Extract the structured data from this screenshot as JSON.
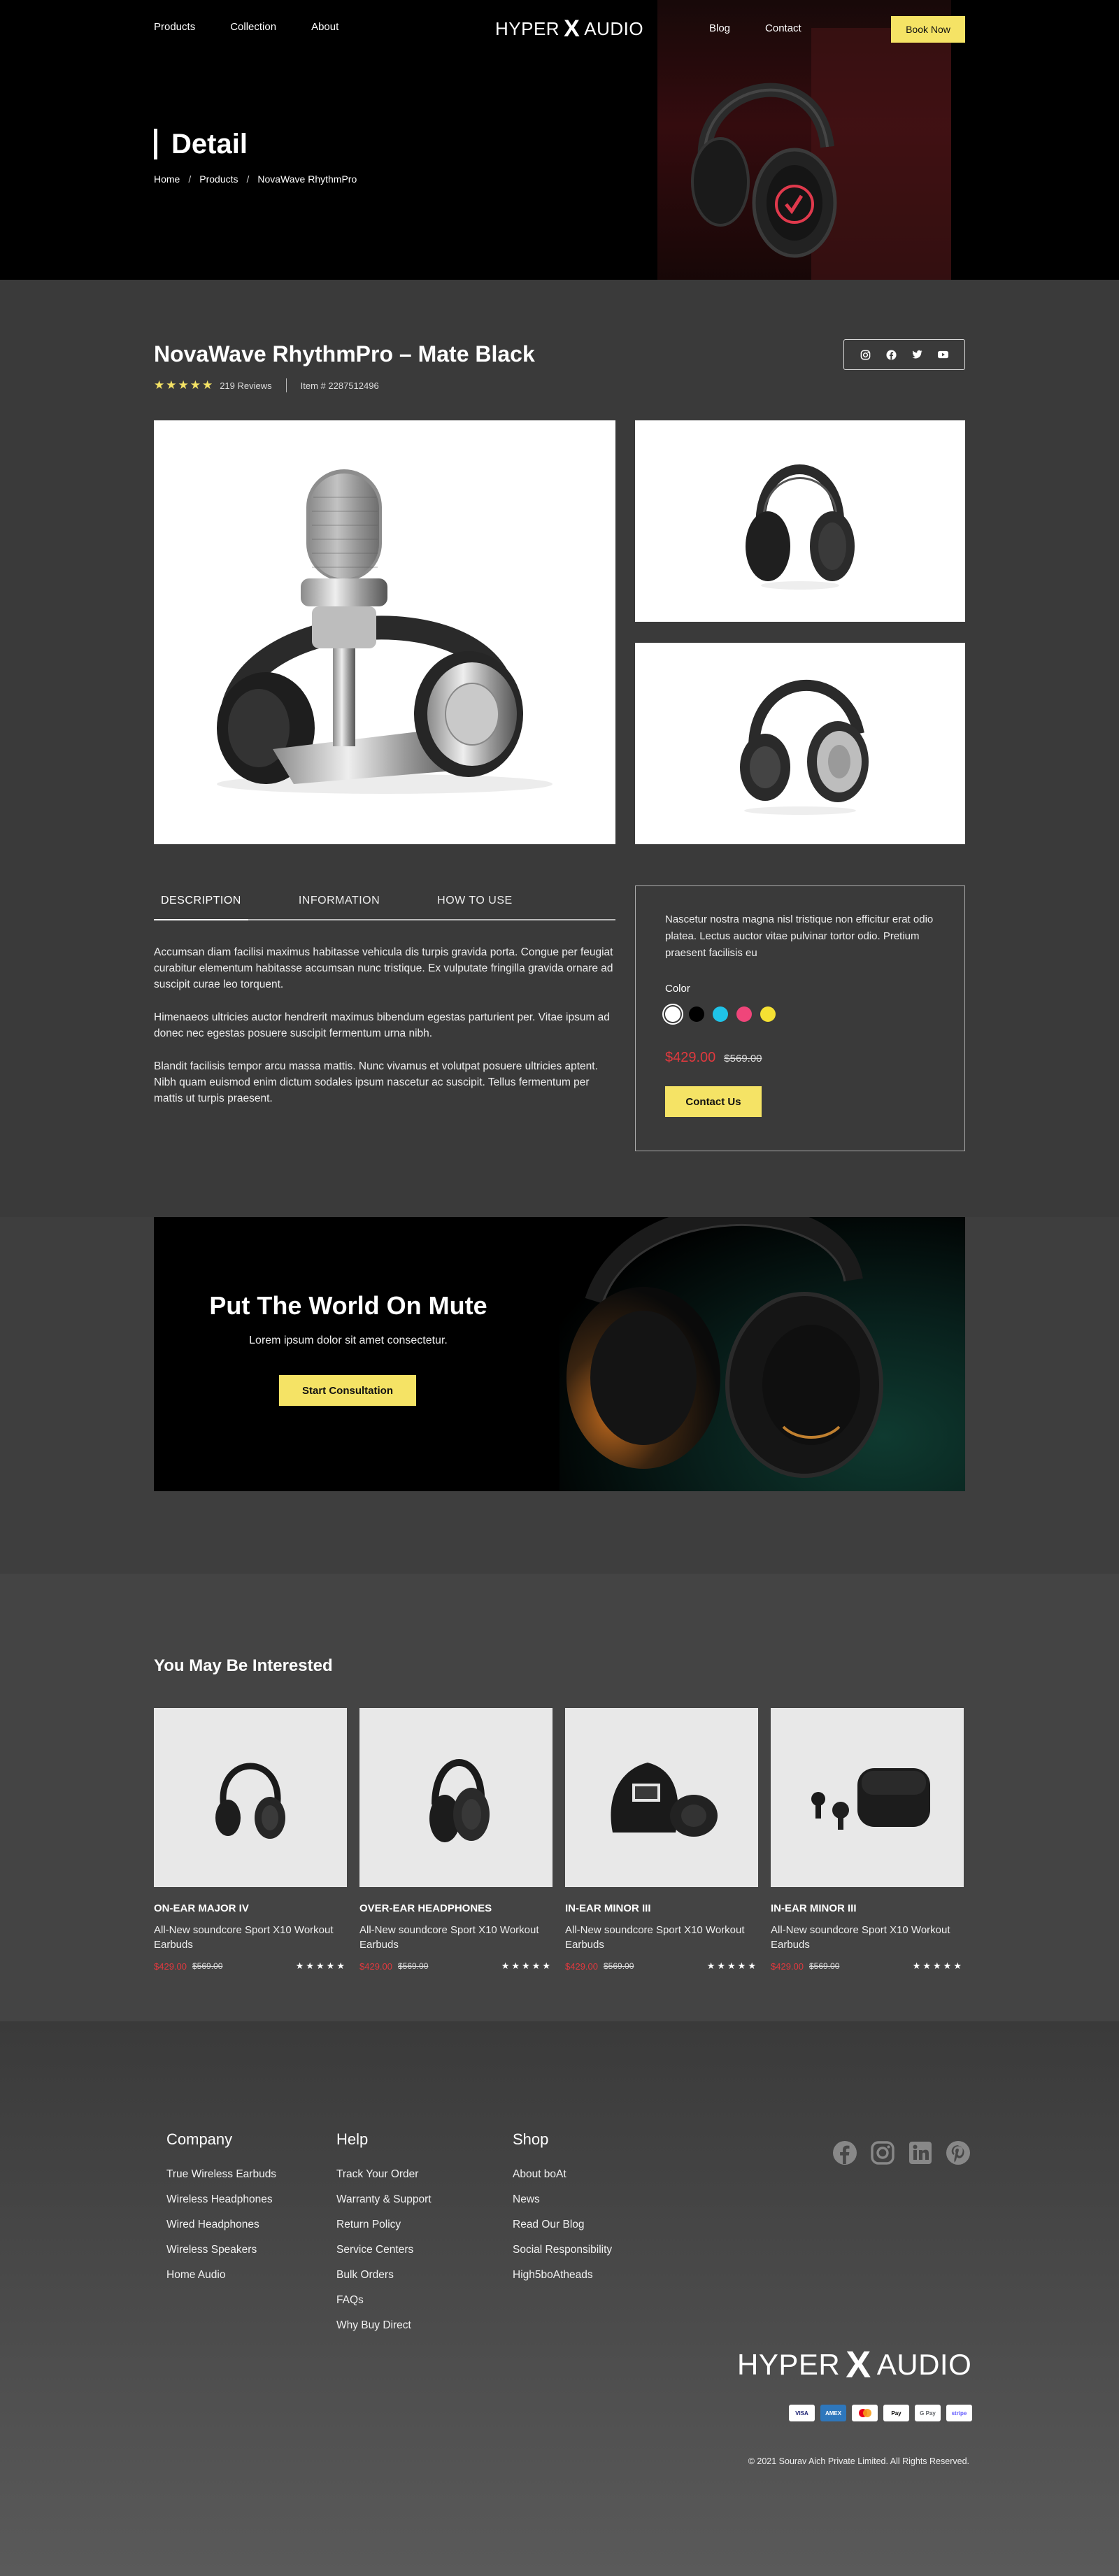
{
  "nav": {
    "left": [
      "Products",
      "Collection",
      "About"
    ],
    "right": [
      "Blog",
      "Contact"
    ],
    "logo_left": "HYPER",
    "logo_x": "X",
    "logo_right": "AUDIO",
    "cta": "Book Now"
  },
  "hero": {
    "title": "Detail",
    "breadcrumb": [
      "Home",
      "Products",
      "NovaWave RhythmPro"
    ],
    "sep": "/"
  },
  "product": {
    "title": "NovaWave RhythmPro – Mate Black",
    "rating": 5,
    "reviews": "219 Reviews",
    "item": "Item # 2287512496",
    "share_icons": [
      "instagram-icon",
      "facebook-icon",
      "twitter-icon",
      "youtube-icon"
    ],
    "tabs": [
      "DESCRIPTION",
      "INFORMATION",
      "HOW TO USE"
    ],
    "active_tab": 0,
    "description": [
      "Accumsan diam facilisi maximus habitasse vehicula dis turpis gravida porta. Congue per feugiat curabitur elementum habitasse accumsan nunc tristique. Ex vulputate fringilla gravida ornare ad suscipit curae leo torquent.",
      "Himenaeos ultricies auctor hendrerit maximus bibendum egestas parturient per. Vitae ipsum ad donec nec egestas posuere suscipit fermentum urna nibh.",
      "Blandit facilisis tempor arcu massa mattis. Nunc vivamus et volutpat posuere ultricies aptent. Nibh quam euismod enim dictum sodales ipsum nascetur ac suscipit. Tellus fermentum per mattis ut turpis praesent."
    ],
    "buy_text": "Nascetur nostra magna nisl tristique non efficitur erat odio platea. Lectus auctor vitae pulvinar tortor odio. Pretium praesent facilisis eu",
    "color_label": "Color",
    "colors": [
      "#ffffff",
      "#000000",
      "#1fc3e8",
      "#f0457a",
      "#f5e133"
    ],
    "selected_color": 0,
    "price": "$429.00",
    "old_price": "$569.00",
    "contact": "Contact Us"
  },
  "banner": {
    "title": "Put The World On Mute",
    "subtitle": "Lorem ipsum dolor sit amet consectetur.",
    "cta": "Start Consultation"
  },
  "related": {
    "title": "You May Be Interested",
    "items": [
      {
        "name": "ON-EAR MAJOR IV",
        "desc": "All-New soundcore Sport X10 Workout Earbuds",
        "price": "$429.00",
        "old": "$569.00",
        "stars": "★★★★★"
      },
      {
        "name": "OVER-EAR HEADPHONES",
        "desc": "All-New soundcore Sport X10 Workout Earbuds",
        "price": "$429.00",
        "old": "$569.00",
        "stars": "★★★★★"
      },
      {
        "name": "IN-EAR MINOR III",
        "desc": "All-New soundcore Sport X10 Workout Earbuds",
        "price": "$429.00",
        "old": "$569.00",
        "stars": "★★★★★"
      },
      {
        "name": "IN-EAR MINOR III",
        "desc": "All-New soundcore Sport X10 Workout Earbuds",
        "price": "$429.00",
        "old": "$569.00",
        "stars": "★★★★★"
      }
    ]
  },
  "footer": {
    "company": {
      "title": "Company",
      "links": [
        "True Wireless Earbuds",
        "Wireless Headphones",
        "Wired Headphones",
        "Wireless Speakers",
        "Home Audio"
      ]
    },
    "help": {
      "title": "Help",
      "links": [
        "Track Your Order",
        "Warranty & Support",
        "Return Policy",
        "Service Centers",
        "Bulk Orders",
        "FAQs",
        "Why Buy Direct"
      ]
    },
    "shop": {
      "title": "Shop",
      "links": [
        "About boAt",
        "News",
        "Read Our Blog",
        "Social Responsibility",
        "High5boAtheads"
      ]
    },
    "social_icons": [
      "facebook-icon",
      "instagram-icon",
      "linkedin-icon",
      "pinterest-icon"
    ],
    "payments": [
      "VISA",
      "AMEX",
      "MC",
      "Pay",
      "G Pay",
      "stripe"
    ],
    "copyright": "© 2021 Sourav Aich Private Limited. All Rights Reserved."
  }
}
